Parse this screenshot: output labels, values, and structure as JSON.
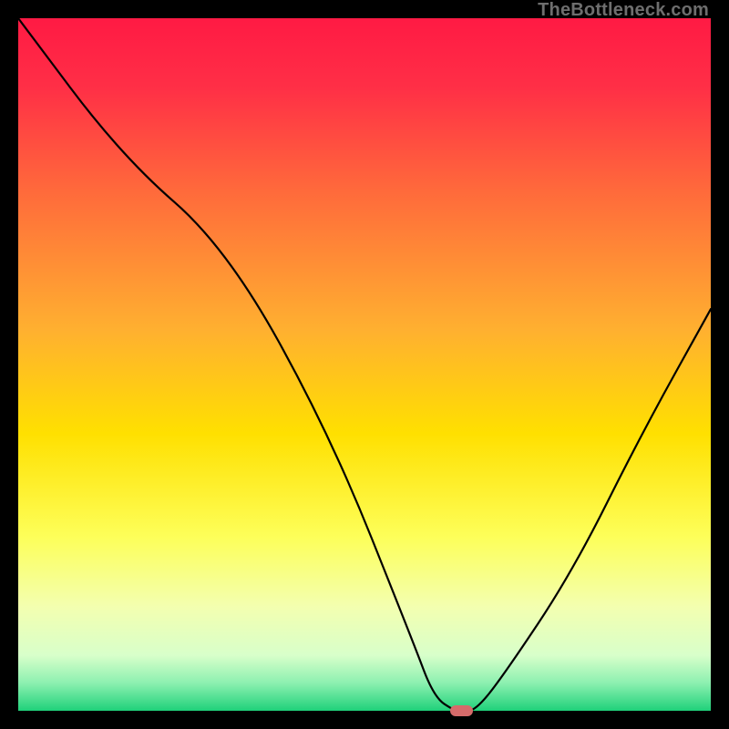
{
  "watermark": "TheBottleneck.com",
  "chart_data": {
    "type": "line",
    "title": "",
    "xlabel": "",
    "ylabel": "",
    "xlim": [
      0,
      100
    ],
    "ylim": [
      0,
      100
    ],
    "x": [
      0,
      15,
      30,
      45,
      57,
      60,
      63,
      64,
      66,
      70,
      80,
      90,
      100
    ],
    "values": [
      100,
      80,
      67,
      40,
      10,
      2,
      0,
      0,
      0,
      5,
      20,
      40,
      58
    ],
    "marker": {
      "x": 64,
      "y": 0,
      "color": "#d66a6a",
      "w": 3.2,
      "h": 1.6
    },
    "gradient_stops": [
      {
        "pos": 0.0,
        "color": "#ff1a44"
      },
      {
        "pos": 0.1,
        "color": "#ff2f46"
      },
      {
        "pos": 0.25,
        "color": "#ff6a3b"
      },
      {
        "pos": 0.45,
        "color": "#ffb030"
      },
      {
        "pos": 0.6,
        "color": "#ffe000"
      },
      {
        "pos": 0.75,
        "color": "#fdff5a"
      },
      {
        "pos": 0.85,
        "color": "#f3ffb0"
      },
      {
        "pos": 0.92,
        "color": "#d8ffca"
      },
      {
        "pos": 0.96,
        "color": "#8cf0b0"
      },
      {
        "pos": 1.0,
        "color": "#1fd17a"
      }
    ]
  }
}
